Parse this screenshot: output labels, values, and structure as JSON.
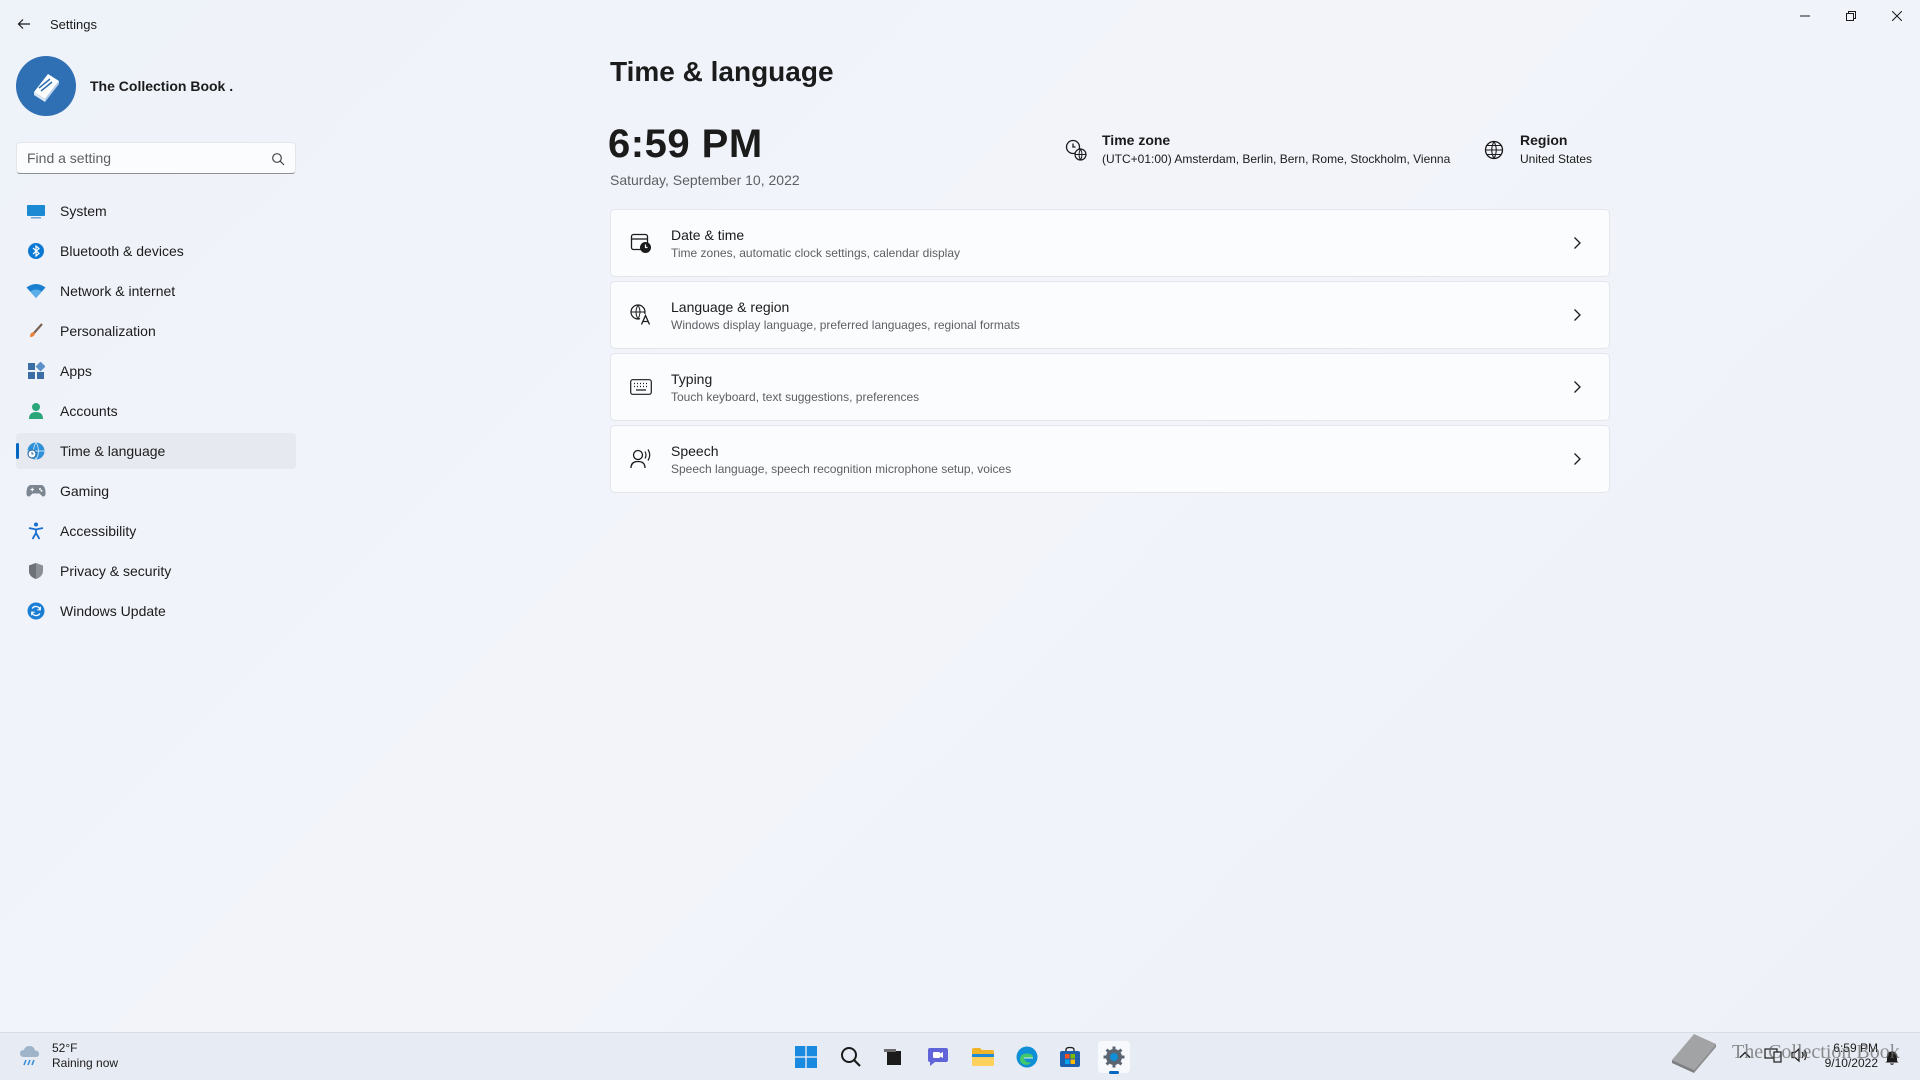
{
  "window": {
    "title": "Settings"
  },
  "profile": {
    "name": "The Collection Book ."
  },
  "search": {
    "placeholder": "Find a setting"
  },
  "sidebar": {
    "items": [
      {
        "label": "System",
        "icon": "monitor-icon",
        "active": false
      },
      {
        "label": "Bluetooth & devices",
        "icon": "bluetooth-icon",
        "active": false
      },
      {
        "label": "Network & internet",
        "icon": "wifi-icon",
        "active": false
      },
      {
        "label": "Personalization",
        "icon": "brush-icon",
        "active": false
      },
      {
        "label": "Apps",
        "icon": "apps-icon",
        "active": false
      },
      {
        "label": "Accounts",
        "icon": "person-icon",
        "active": false
      },
      {
        "label": "Time & language",
        "icon": "globe-clock-icon",
        "active": true
      },
      {
        "label": "Gaming",
        "icon": "gamepad-icon",
        "active": false
      },
      {
        "label": "Accessibility",
        "icon": "accessibility-icon",
        "active": false
      },
      {
        "label": "Privacy & security",
        "icon": "shield-icon",
        "active": false
      },
      {
        "label": "Windows Update",
        "icon": "update-icon",
        "active": false
      }
    ]
  },
  "main": {
    "title": "Time & language",
    "clock": "6:59 PM",
    "date": "Saturday, September 10, 2022",
    "timezone": {
      "title": "Time zone",
      "value": "(UTC+01:00) Amsterdam, Berlin, Bern, Rome, Stockholm, Vienna"
    },
    "region": {
      "title": "Region",
      "value": "United States"
    },
    "cards": [
      {
        "title": "Date & time",
        "subtitle": "Time zones, automatic clock settings, calendar display",
        "icon": "calendar-clock-icon"
      },
      {
        "title": "Language & region",
        "subtitle": "Windows display language, preferred languages, regional formats",
        "icon": "language-icon"
      },
      {
        "title": "Typing",
        "subtitle": "Touch keyboard, text suggestions, preferences",
        "icon": "keyboard-icon"
      },
      {
        "title": "Speech",
        "subtitle": "Speech language, speech recognition microphone setup, voices",
        "icon": "speech-icon"
      }
    ]
  },
  "taskbar": {
    "weather_temp": "52°F",
    "weather_desc": "Raining now",
    "apps": [
      "start-icon",
      "search-icon",
      "task-view-icon",
      "chat-icon",
      "file-explorer-icon",
      "edge-icon",
      "store-icon",
      "settings-icon"
    ],
    "clock_time": "6:59 PM",
    "clock_date": "9/10/2022",
    "watermark": "The Collection Book"
  },
  "colors": {
    "accent": "#0067c0",
    "background": "#eef2f9",
    "card": "#fbfcfe"
  }
}
